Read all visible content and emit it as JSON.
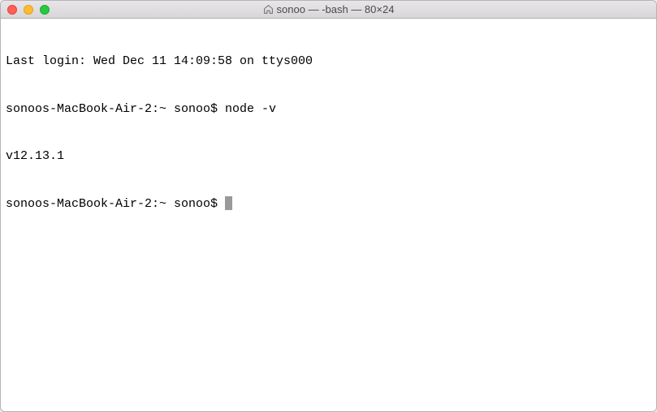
{
  "titlebar": {
    "title": "sonoo — -bash — 80×24"
  },
  "terminal": {
    "lines": {
      "l0": "Last login: Wed Dec 11 14:09:58 on ttys000",
      "l1_prompt": "sonoos-MacBook-Air-2:~ sonoo$ ",
      "l1_cmd": "node -v",
      "l2": "v12.13.1",
      "l3_prompt": "sonoos-MacBook-Air-2:~ sonoo$ "
    }
  }
}
